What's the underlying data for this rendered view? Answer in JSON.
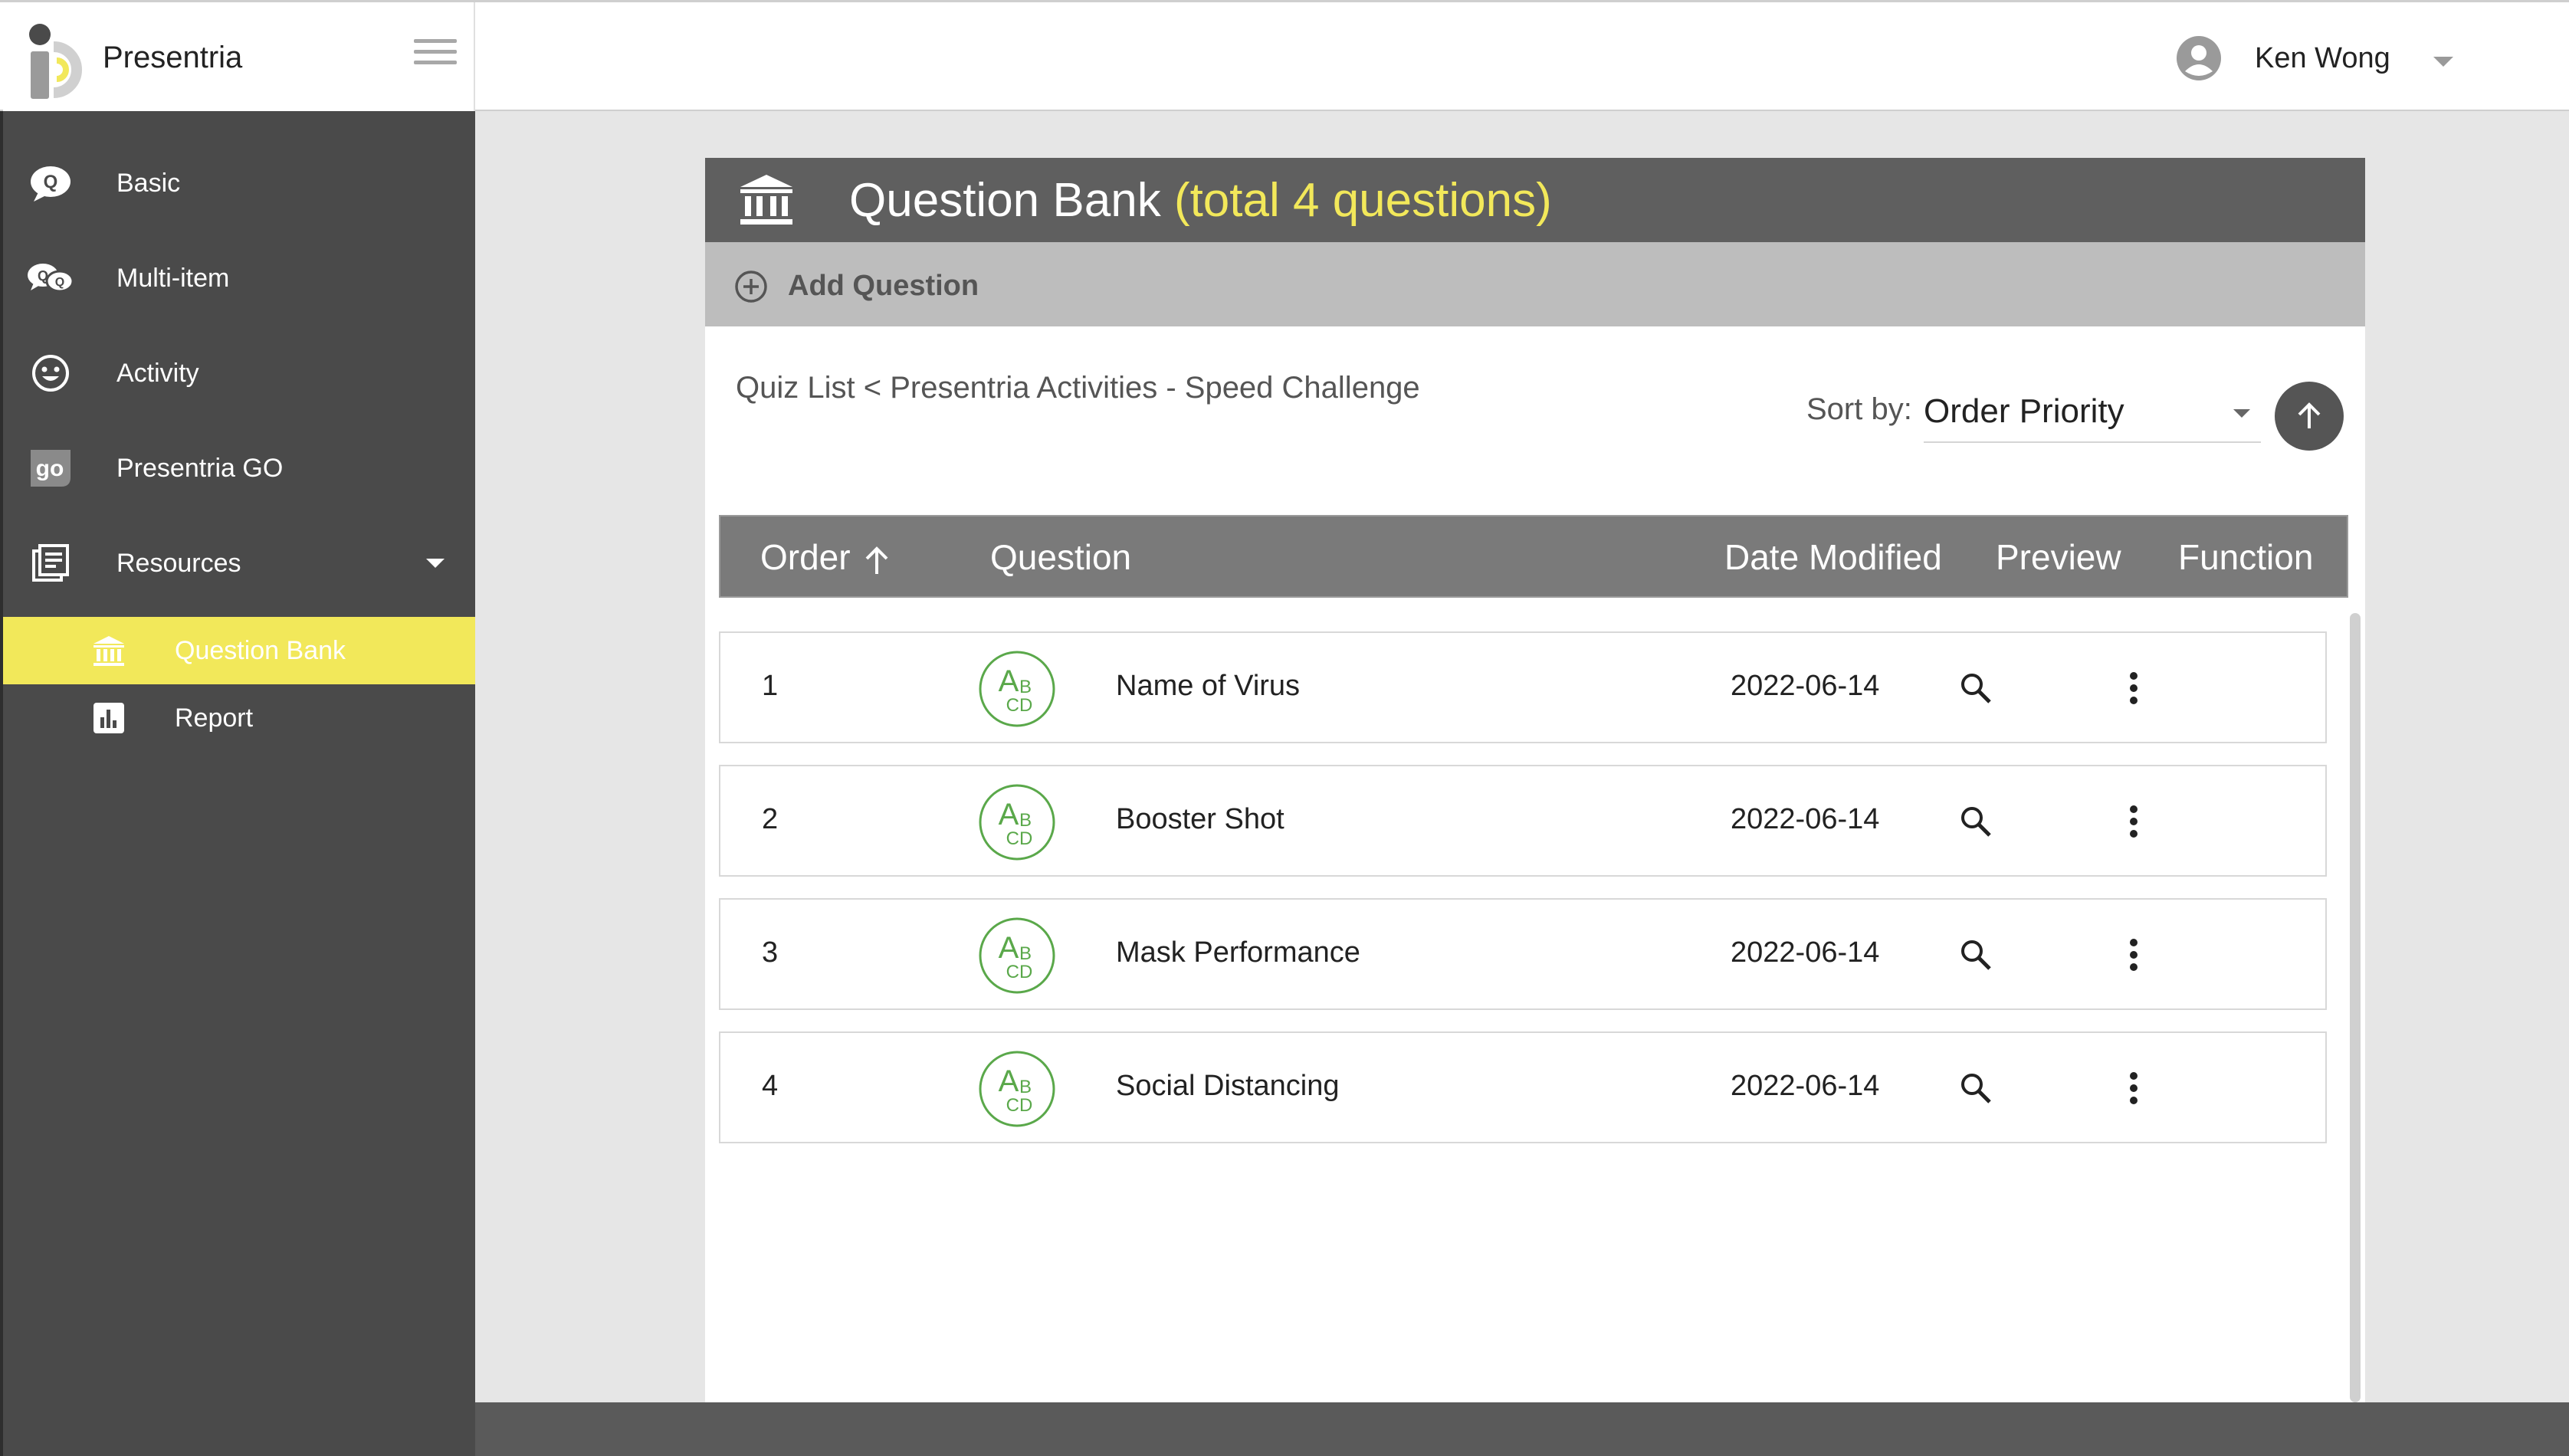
{
  "app": {
    "brand": "Presentria",
    "user_name": "Ken Wong"
  },
  "sidebar": {
    "items": [
      {
        "label": "Basic",
        "icon": "q-bubble-icon"
      },
      {
        "label": "Multi-item",
        "icon": "multi-bubble-icon"
      },
      {
        "label": "Activity",
        "icon": "smiley-icon"
      },
      {
        "label": "Presentria GO",
        "icon": "go-icon"
      },
      {
        "label": "Resources",
        "icon": "resources-icon"
      }
    ],
    "sub_items": [
      {
        "label": "Question Bank",
        "icon": "bank-icon",
        "active": true
      },
      {
        "label": "Report",
        "icon": "bar-chart-icon",
        "active": false
      }
    ]
  },
  "panel": {
    "title": "Question Bank",
    "title_count": "(total 4 questions)",
    "add_label": "Add Question",
    "breadcrumb": "Quiz List < Presentria Activities - Speed Challenge",
    "sort_label": "Sort by:",
    "sort_value": "Order Priority"
  },
  "table": {
    "headers": {
      "order": "Order",
      "question": "Question",
      "date": "Date Modified",
      "preview": "Preview",
      "function": "Function"
    },
    "rows": [
      {
        "order": "1",
        "question": "Name of Virus",
        "date": "2022-06-14"
      },
      {
        "order": "2",
        "question": "Booster Shot",
        "date": "2022-06-14"
      },
      {
        "order": "3",
        "question": "Mask Performance",
        "date": "2022-06-14"
      },
      {
        "order": "4",
        "question": "Social Distancing",
        "date": "2022-06-14"
      }
    ]
  },
  "colors": {
    "accent_yellow": "#f2e85a",
    "sidebar_bg": "#4a4a4a",
    "header_bg": "#5f5f5f",
    "question_icon_green": "#5aa84a"
  }
}
